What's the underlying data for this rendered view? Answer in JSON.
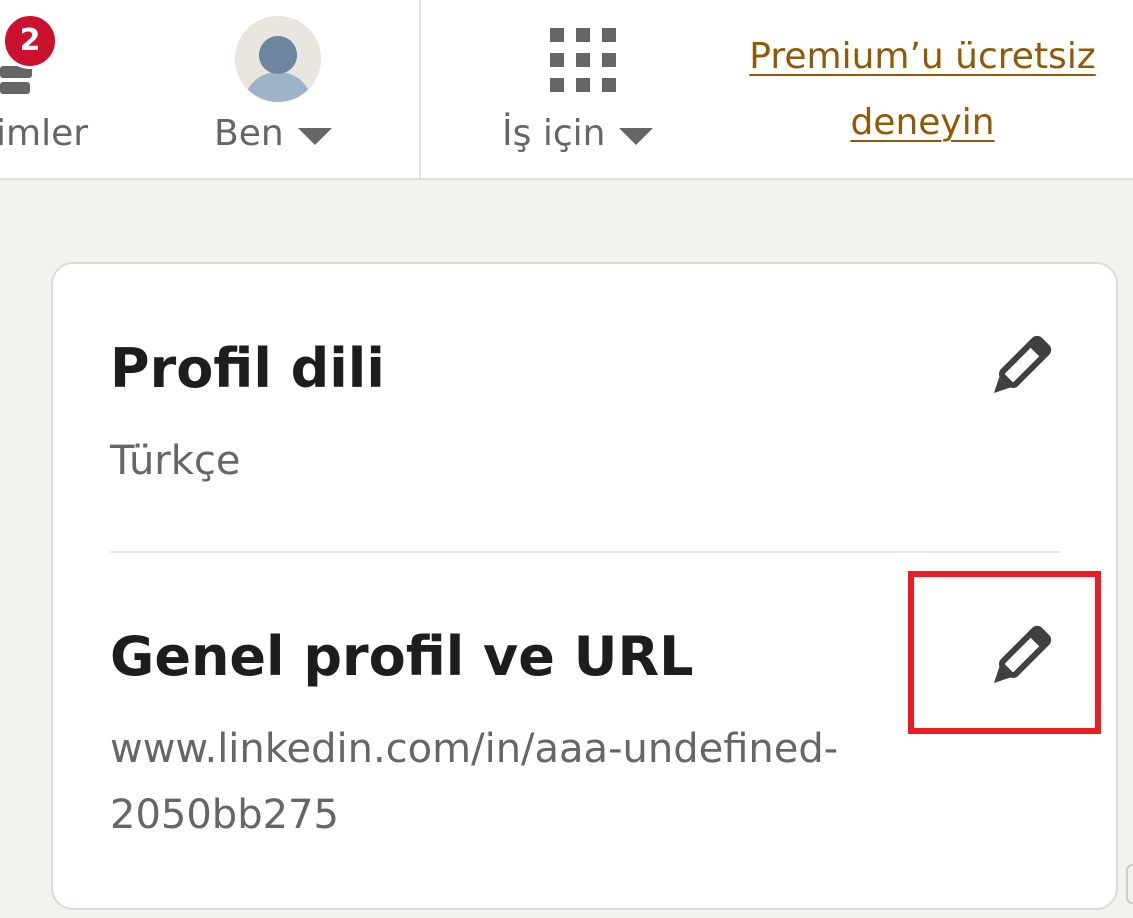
{
  "nav": {
    "notifications": {
      "label": "imler",
      "badge_count": "2",
      "icon": "notifications-person-icon"
    },
    "me": {
      "label": "Ben",
      "icon": "avatar",
      "caret_icon": "caret-down-icon"
    },
    "work": {
      "label": "İş için",
      "icon": "grid-apps-icon",
      "caret_icon": "caret-down-icon"
    },
    "premium": {
      "line1": "Premium’u ücretsiz",
      "line2": "deneyin",
      "color": "#915907"
    }
  },
  "card": {
    "profile_language": {
      "title": "Profil dili",
      "value": "Türkçe",
      "edit_icon": "pencil-icon"
    },
    "public_profile": {
      "title": "Genel profil ve URL",
      "url_line1": "www.linkedin.com/in/aaa-undefined-",
      "url_line2": "2050bb275",
      "edit_icon": "pencil-icon"
    }
  },
  "colors": {
    "badge": "#cb112d",
    "highlight": "#ec1c24",
    "text_primary": "#1d1d1d",
    "text_secondary": "#666666",
    "background": "#f3f2ef"
  }
}
